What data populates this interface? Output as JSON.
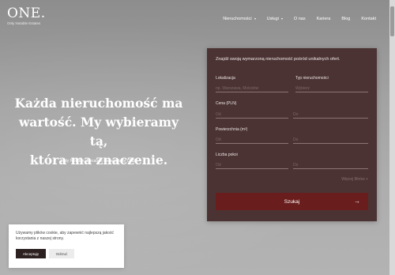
{
  "brand": {
    "logo_title": "ONE.",
    "logo_subtitle": "Only Notable Estates"
  },
  "nav": {
    "items": [
      {
        "label": "Nieruchomości",
        "has_dropdown": true
      },
      {
        "label": "Usługi",
        "has_dropdown": true
      },
      {
        "label": "O nas",
        "has_dropdown": false
      },
      {
        "label": "Kariera",
        "has_dropdown": false
      },
      {
        "label": "Blog",
        "has_dropdown": false
      },
      {
        "label": "Kontakt",
        "has_dropdown": false
      }
    ]
  },
  "hero": {
    "title_line1": "Każda nieruchomość ma",
    "title_line2": "wartość. My wybieramy tą,",
    "title_line3": "która ma znaczenie.",
    "subtitle": "Only Notable. Because there is only ONE."
  },
  "search": {
    "intro": "Znajdź swoją wymarzoną nieruchomość pośród unikalnych ofert.",
    "location_label": "Lokalizacja",
    "location_placeholder": "np. Warszawa, Mokotów",
    "type_label": "Typ nieruchomości",
    "type_value": "Wybierz",
    "price_label": "Cena (PLN)",
    "price_from": "Od",
    "price_to": "Do",
    "area_label": "Powierzchnia (m²)",
    "area_from": "Od",
    "area_to": "Do",
    "rooms_label": "Liczba pokoi",
    "rooms_from": "Od",
    "rooms_to": "Do",
    "more_link": "Więcej filtrów +",
    "button_label": "Szukaj",
    "button_arrow": "→"
  },
  "cookie": {
    "text": "Używamy plików cookie, aby zapewnić najlepszą jakość korzystania z naszej strony.",
    "accept_label": "Akceptuję",
    "reject_label": "Odrzuć"
  },
  "colors": {
    "panel": "#4b3333",
    "button": "#6a1d1d",
    "accept": "#2c2020"
  }
}
